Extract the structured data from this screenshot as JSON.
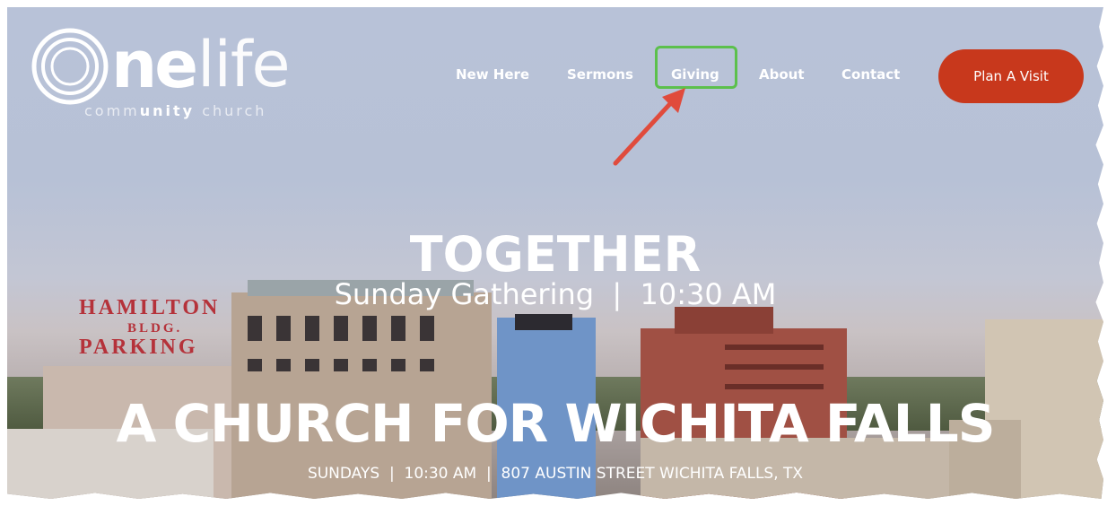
{
  "logo": {
    "mark": "ne",
    "word": "life",
    "sub_pre": "comm",
    "sub_bold": "unity",
    "sub_post": " church"
  },
  "nav": {
    "items": [
      "New Here",
      "Sermons",
      "Giving",
      "About",
      "Contact"
    ],
    "cta": "Plan A Visit"
  },
  "hero": {
    "kicker": "TOGETHER",
    "subline": "Sunday Gathering  |  10:30 AM",
    "title": "A CHURCH FOR WICHITA FALLS",
    "info": "SUNDAYS  |  10:30 AM  |  807 AUSTIN STREET WICHITA FALLS, TX"
  },
  "signage": {
    "line1": "HAMILTON",
    "line2": "BLDG.",
    "line3": "PARKING"
  },
  "colors": {
    "accent_cta": "#c8381c",
    "highlight_box": "#5cc04c",
    "arrow": "#e04b3c"
  }
}
